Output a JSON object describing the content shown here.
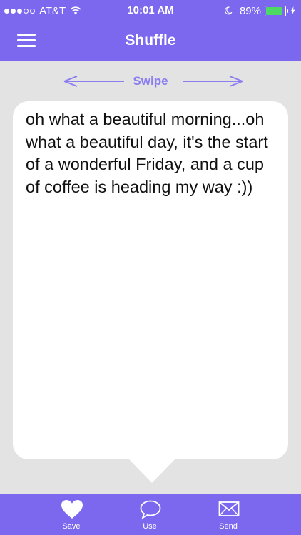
{
  "status_bar": {
    "carrier": "AT&T",
    "time": "10:01 AM",
    "battery_percent": "89%",
    "battery_level": 0.89,
    "battery_color": "#4cd964"
  },
  "nav": {
    "title": "Shuffle",
    "menu_icon": "hamburger-menu-icon"
  },
  "swipe": {
    "label": "Swipe"
  },
  "quote": {
    "text": "oh what a beautiful morning...oh what a beautiful day, it's the start of a wonderful Friday, and a cup of coffee is heading my way :))"
  },
  "tabs": [
    {
      "label": "Save",
      "icon": "heart-icon"
    },
    {
      "label": "Use",
      "icon": "speech-bubble-icon"
    },
    {
      "label": "Send",
      "icon": "envelope-icon"
    }
  ],
  "colors": {
    "primary": "#7b68ee",
    "accent": "#8b7ef0",
    "background": "#e3e3e3"
  }
}
